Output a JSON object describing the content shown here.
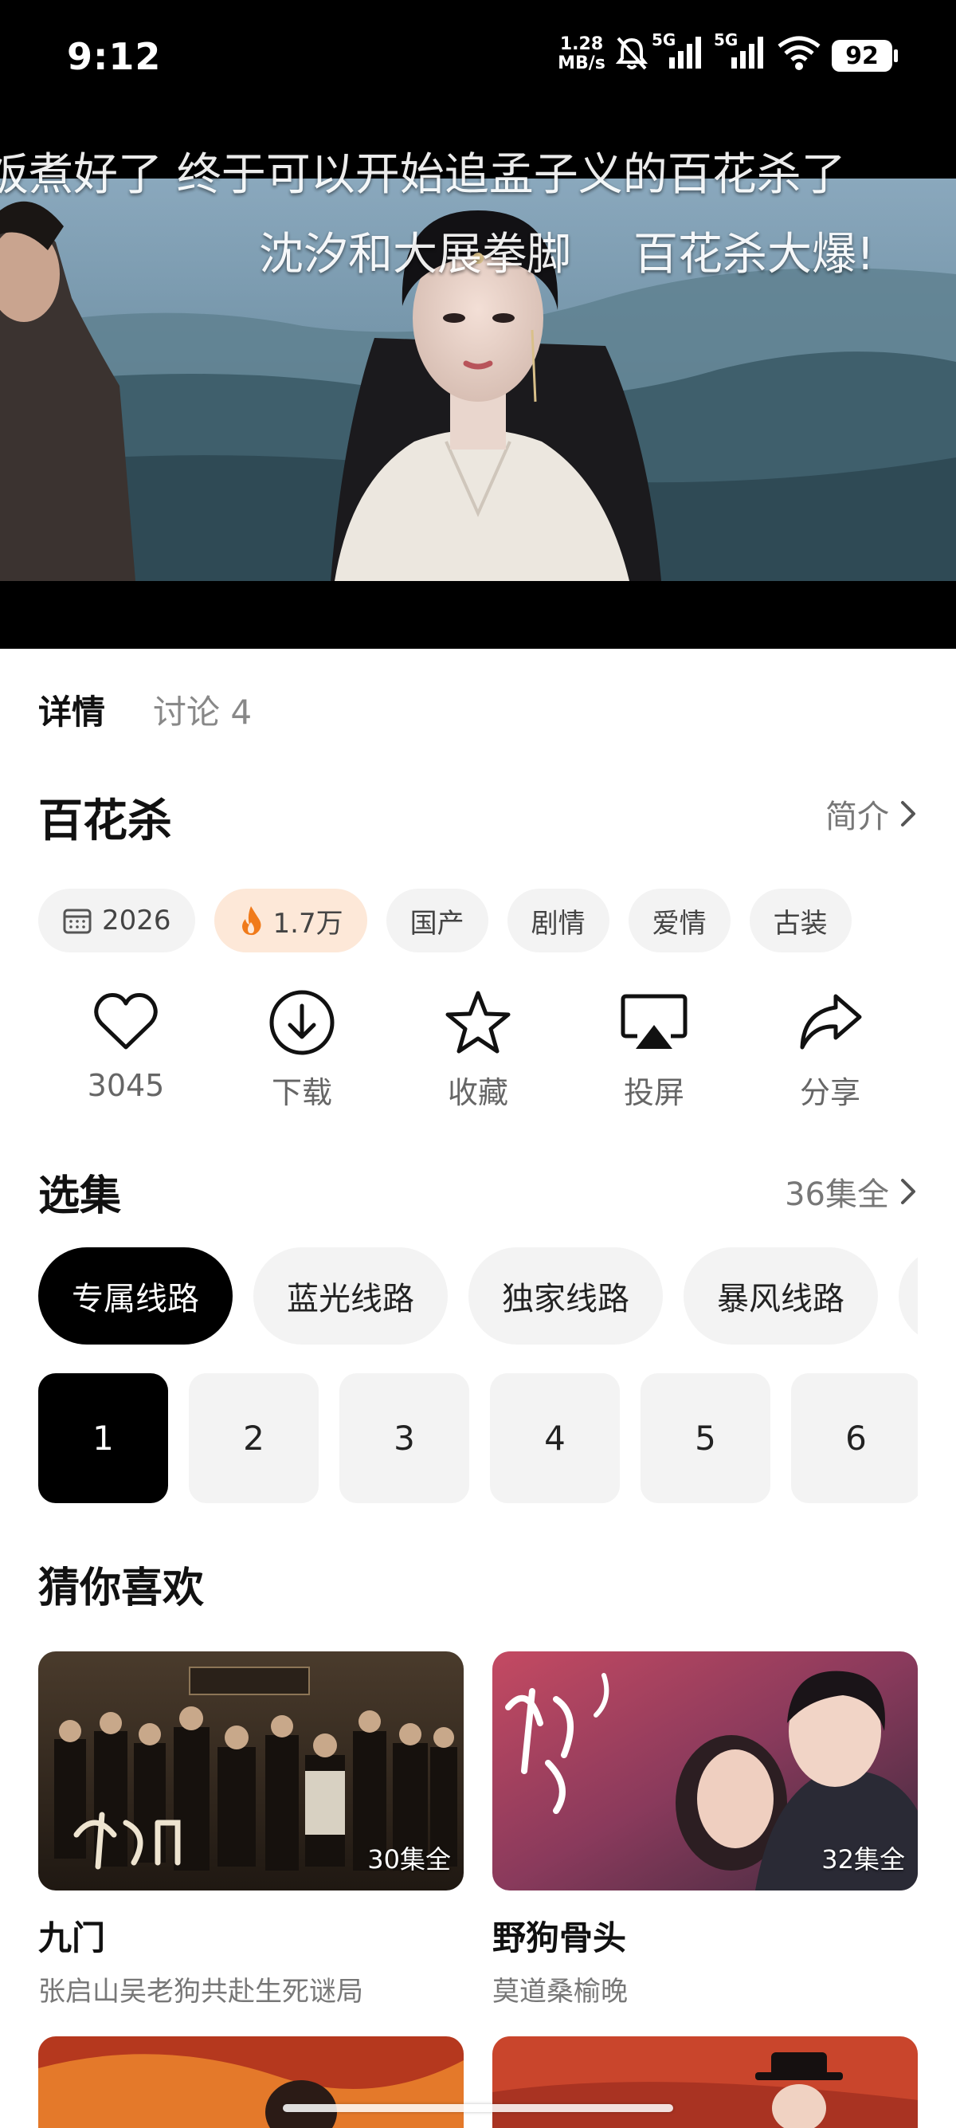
{
  "status_bar": {
    "time": "9:12",
    "net_speed": "1.28",
    "net_unit": "MB/s",
    "signal_1_label": "5G",
    "signal_2_label": "5G",
    "battery": "92"
  },
  "video": {
    "danmaku": [
      "饭煮好了 终于可以开始追孟子义的百花杀了",
      "沈汐和大展拳脚",
      "百花杀大爆!"
    ]
  },
  "tabs": [
    {
      "label": "详情",
      "active": true
    },
    {
      "label": "讨论 4",
      "active": false
    }
  ],
  "title": "百花杀",
  "intro_link": "简介",
  "chips": {
    "year": "2026",
    "heat": "1.7万",
    "tags": [
      "国产",
      "剧情",
      "爱情",
      "古装"
    ]
  },
  "actions": [
    {
      "icon": "heart-icon",
      "label": "3045"
    },
    {
      "icon": "download-icon",
      "label": "下载"
    },
    {
      "icon": "star-icon",
      "label": "收藏"
    },
    {
      "icon": "cast-icon",
      "label": "投屏"
    },
    {
      "icon": "share-icon",
      "label": "分享"
    }
  ],
  "episodes_section": {
    "title": "选集",
    "total": "36集全",
    "routes": [
      "专属线路",
      "蓝光线路",
      "独家线路",
      "暴风线路",
      ""
    ],
    "active_route": 0,
    "episodes": [
      "1",
      "2",
      "3",
      "4",
      "5",
      "6"
    ],
    "active_episode": 0
  },
  "recommend": {
    "title": "猜你喜欢",
    "items": [
      {
        "name": "九门",
        "desc": "张启山吴老狗共赴生死谜局",
        "badge": "30集全"
      },
      {
        "name": "野狗骨头",
        "desc": "莫道桑榆晚",
        "badge": "32集全"
      }
    ]
  },
  "colors": {
    "accent": "#000000",
    "chip_bg": "#f3f3f3",
    "hot_chip_bg": "#fde8d8",
    "flame": "#f07a1a"
  }
}
